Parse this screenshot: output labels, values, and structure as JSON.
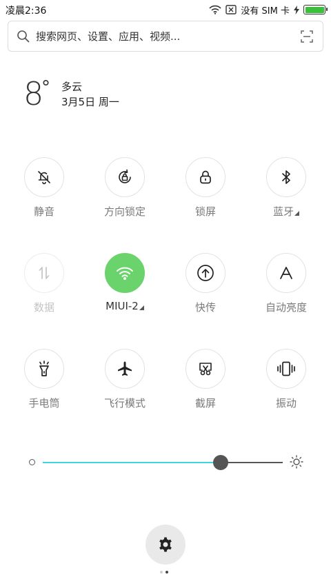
{
  "status_bar": {
    "time": "凌晨2:36",
    "carrier": "没有 SIM 卡",
    "battery_level": 1.0,
    "icons": [
      "wifi-icon",
      "sim-x-icon",
      "charging-bolt-icon",
      "battery-icon"
    ]
  },
  "search": {
    "placeholder": "搜索网页、设置、应用、视频...",
    "value": "",
    "icons": [
      "search-icon",
      "scan-icon"
    ]
  },
  "weather": {
    "temperature": "8",
    "degree": "°",
    "condition": "多云",
    "date": "3月5日 周一"
  },
  "toggles": [
    {
      "label": "静音",
      "icon": "bell-off-icon",
      "state": "off"
    },
    {
      "label": "方向锁定",
      "icon": "rotation-lock-icon",
      "state": "off"
    },
    {
      "label": "锁屏",
      "icon": "lock-icon",
      "state": "off"
    },
    {
      "label": "蓝牙",
      "icon": "bluetooth-icon",
      "state": "off",
      "has_more": true
    },
    {
      "label": "数据",
      "icon": "data-arrows-icon",
      "state": "disabled"
    },
    {
      "label": "MIUI-2",
      "icon": "wifi-icon",
      "state": "on",
      "has_more": true
    },
    {
      "label": "快传",
      "icon": "upload-icon",
      "state": "off"
    },
    {
      "label": "自动亮度",
      "icon": "auto-brightness-icon",
      "state": "off"
    },
    {
      "label": "手电筒",
      "icon": "flashlight-icon",
      "state": "off"
    },
    {
      "label": "飞行模式",
      "icon": "airplane-icon",
      "state": "off"
    },
    {
      "label": "截屏",
      "icon": "screenshot-icon",
      "state": "off"
    },
    {
      "label": "振动",
      "icon": "vibrate-icon",
      "state": "off"
    }
  ],
  "brightness": {
    "level": 0.74
  },
  "colors": {
    "wifi_active": "#6bd36b",
    "brightness_fill": "#3dd6dc",
    "battery": "#3cc03c"
  },
  "pager": {
    "count": 2,
    "active_index": 1
  }
}
